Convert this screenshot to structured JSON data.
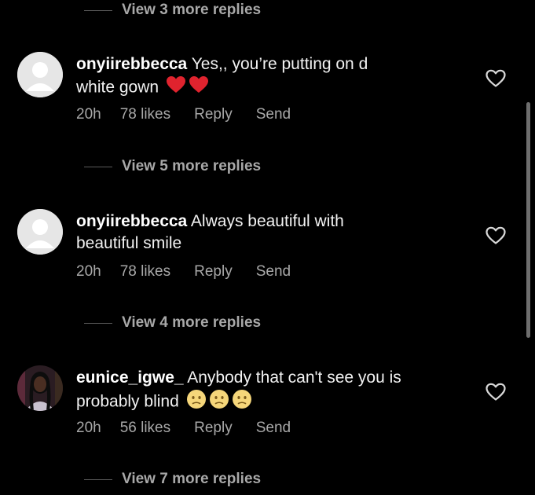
{
  "threads": [
    {
      "view_replies_label": "View 3 more replies"
    },
    {
      "username": "onyiirebbecca",
      "text": "Yes,, you’re putting on d white gown",
      "emoji": [
        "red-heart",
        "red-heart"
      ],
      "time": "20h",
      "likes": "78 likes",
      "reply_label": "Reply",
      "send_label": "Send",
      "view_replies_label": "View 5 more replies"
    },
    {
      "username": "onyiirebbecca",
      "text": "Always beautiful with beautiful smile",
      "emoji": [],
      "time": "20h",
      "likes": "78 likes",
      "reply_label": "Reply",
      "send_label": "Send",
      "view_replies_label": "View 4 more replies"
    },
    {
      "username": "eunice_igwe_",
      "text": "Anybody that can't see you is probably blind",
      "emoji": [
        "wan-face",
        "wan-face",
        "wan-face"
      ],
      "time": "20h",
      "likes": "56 likes",
      "reply_label": "Reply",
      "send_label": "Send",
      "view_replies_label": "View 7 more replies"
    }
  ],
  "icons": {
    "like": "heart-outline-icon",
    "default_avatar": "default-avatar-icon"
  },
  "colors": {
    "background": "#000000",
    "primary_text": "#f2f2f2",
    "secondary_text": "#a8a8a8",
    "heart_red": "#e0232e",
    "emoji_yellow": "#f5d67a"
  }
}
